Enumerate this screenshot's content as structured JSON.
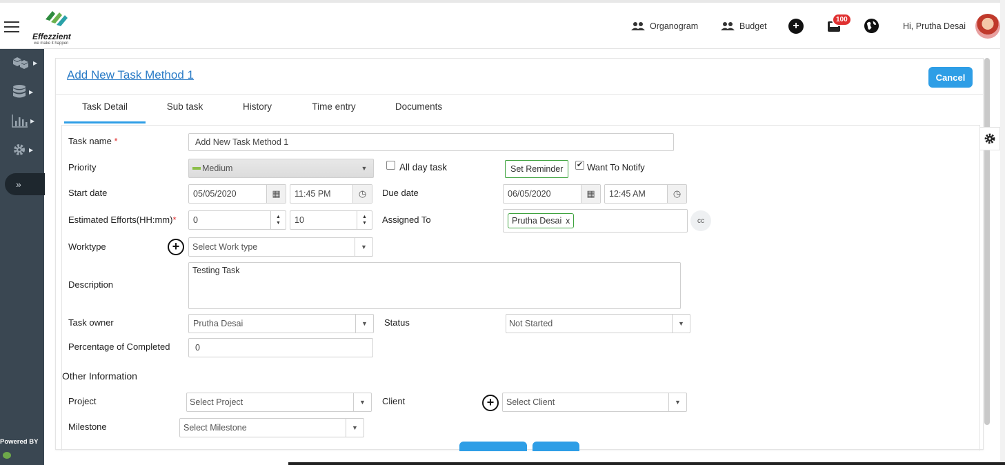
{
  "header": {
    "brand": "Effezzient",
    "tagline": "we make it happen",
    "nav": [
      {
        "label": "Organogram",
        "icon": "people-icon"
      },
      {
        "label": "Budget",
        "icon": "people-icon"
      }
    ],
    "notification_count": "100",
    "greeting": "Hi, Prutha Desai"
  },
  "sidebar": {
    "items": [
      {
        "icon": "cubes-icon"
      },
      {
        "icon": "database-icon"
      },
      {
        "icon": "bar-chart-icon"
      },
      {
        "icon": "gear-icon"
      }
    ],
    "toggle_glyph": "»",
    "powered_by": "Powered BY"
  },
  "page": {
    "title": "Add New Task Method 1",
    "cancel_label": "Cancel"
  },
  "tabs": [
    {
      "label": "Task Detail",
      "active": true
    },
    {
      "label": "Sub task",
      "active": false
    },
    {
      "label": "History",
      "active": false
    },
    {
      "label": "Time entry",
      "active": false
    },
    {
      "label": "Documents",
      "active": false
    }
  ],
  "form": {
    "task_name": {
      "label": "Task name",
      "required_mark": "*",
      "value": "Add New Task Method 1"
    },
    "priority": {
      "label": "Priority",
      "value": "Medium",
      "swatch_color": "#8cbf4a"
    },
    "all_day": {
      "label": "All day task",
      "checked": false
    },
    "reminder": {
      "label": "Set Reminder"
    },
    "notify": {
      "label": "Want To Notify",
      "checked": true,
      "check_glyph": "✔"
    },
    "start_date": {
      "label": "Start date",
      "date": "05/05/2020",
      "time": "11:45 PM"
    },
    "due_date": {
      "label": "Due date",
      "date": "06/05/2020",
      "time": "12:45 AM"
    },
    "efforts": {
      "label": "Estimated Efforts(HH:mm)",
      "required_mark": "*",
      "hours": "0",
      "minutes": "10"
    },
    "assigned_to": {
      "label": "Assigned To",
      "chip": "Prutha Desai",
      "remove_glyph": "x",
      "cc_label": "cc"
    },
    "worktype": {
      "label": "Worktype",
      "placeholder": "Select Work type"
    },
    "description": {
      "label": "Description",
      "value": "Testing Task"
    },
    "task_owner": {
      "label": "Task owner",
      "value": "Prutha Desai"
    },
    "status": {
      "label": "Status",
      "value": "Not Started"
    },
    "percentage": {
      "label": "Percentage of Completed",
      "value": "0"
    },
    "other_info": {
      "title": "Other Information"
    },
    "project": {
      "label": "Project",
      "placeholder": "Select Project"
    },
    "client": {
      "label": "Client",
      "placeholder": "Select Client"
    },
    "milestone": {
      "label": "Milestone",
      "placeholder": "Select Milestone"
    }
  },
  "colors": {
    "accent": "#2e9ee6",
    "sidebar_bg": "#3a4752",
    "link": "#2a7bc6",
    "success_border": "#3ea33e",
    "badge": "#e03030"
  }
}
